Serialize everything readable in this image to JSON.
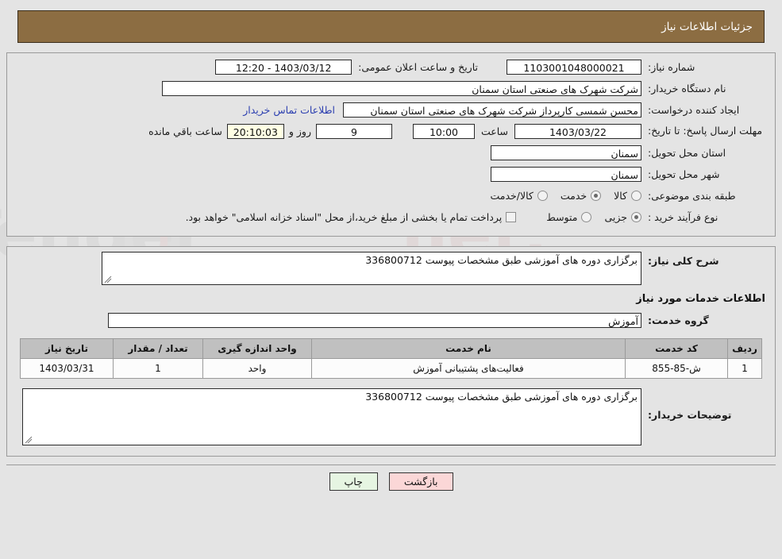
{
  "header": {
    "title": "جزئیات اطلاعات نیاز"
  },
  "watermark": {
    "text": "AnaTender.net"
  },
  "need_info": {
    "need_number_label": "شماره نیاز:",
    "need_number": "1103001048000021",
    "public_announce_label": "تاریخ و ساعت اعلان عمومی:",
    "public_announce_value": "12:20 - 1403/03/12",
    "buyer_org_label": "نام دستگاه خریدار:",
    "buyer_org": "شرکت شهرک های صنعتی استان سمنان",
    "requester_label": "ایجاد کننده درخواست:",
    "requester": "محسن شمسی کارپرداز شرکت شهرک های صنعتی استان سمنان",
    "contact_link": "اطلاعات تماس خریدار",
    "deadline_label": "مهلت ارسال پاسخ: تا تاریخ:",
    "deadline_date": "1403/03/22",
    "hour_label": "ساعت",
    "deadline_time": "10:00",
    "days_remaining": "9",
    "days_word": "روز و",
    "countdown": "20:10:03",
    "remaining_word": "ساعت باقي مانده",
    "province_label": "استان محل تحویل:",
    "province": "سمنان",
    "city_label": "شهر محل تحویل:",
    "city": "سمنان",
    "category_label": "طبقه بندی موضوعی:",
    "category_options": [
      {
        "label": "کالا",
        "selected": false
      },
      {
        "label": "خدمت",
        "selected": true
      },
      {
        "label": "کالا/خدمت",
        "selected": false
      }
    ],
    "process_label": "نوع فرآیند خرید :",
    "process_options": [
      {
        "label": "جزیی",
        "selected": true
      },
      {
        "label": "متوسط",
        "selected": false
      }
    ],
    "treasury_checkbox_checked": false,
    "treasury_note": "پرداخت تمام یا بخشی از مبلغ خرید،از محل \"اسناد خزانه اسلامی\" خواهد بود."
  },
  "general": {
    "summary_label": "شرح کلی نیاز:",
    "summary_text": "برگزاری دوره های آموزشی طبق مشخصات پیوست 336800712",
    "services_section_title": "اطلاعات خدمات مورد نیاز",
    "service_group_label": "گروه خدمت:",
    "service_group": "آموزش"
  },
  "items_table": {
    "columns": [
      "ردیف",
      "کد خدمت",
      "نام خدمت",
      "واحد اندازه گیری",
      "تعداد / مقدار",
      "تاریخ نیاز"
    ],
    "rows": [
      {
        "radif": "1",
        "code": "ش-85-855",
        "name": "فعالیت‌های پشتیبانی آموزش",
        "unit": "واحد",
        "qty": "1",
        "need_date": "1403/03/31"
      }
    ]
  },
  "buyer_notes": {
    "label": "توضیحات خریدار:",
    "text": "برگزاری دوره های آموزشی طبق مشخصات پیوست 336800712"
  },
  "footer": {
    "print_label": "چاپ",
    "back_label": "بازگشت"
  },
  "colors": {
    "header_bg": "#8c6d42",
    "page_bg": "#e4e4e4",
    "link": "#2c3fb0",
    "countdown_bg": "#ffffe4",
    "print_btn": "#e6f5e2",
    "back_btn": "#fbd7d7",
    "table_header": "#c0c0c0"
  }
}
